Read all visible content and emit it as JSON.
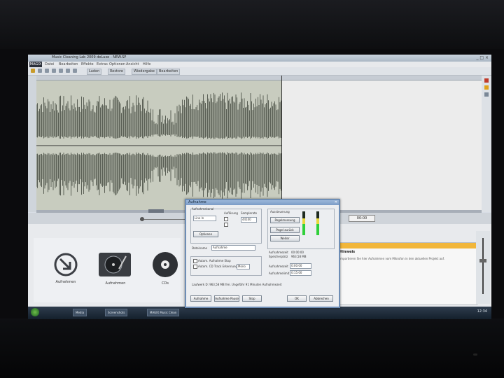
{
  "window": {
    "title": "Music Cleaning Lab 2009 deLuxe - NEW.SP",
    "controls": "_ □ ×"
  },
  "menubar": {
    "logo": "MAGIX",
    "items": [
      "Datei",
      "Bearbeiten",
      "Effekte",
      "Extras",
      "Optionen",
      "Ansicht",
      "Hilfe"
    ]
  },
  "toolbar": {
    "buttons": [
      "Laden",
      "Restore",
      "Wiedergabe",
      "Bearbeiten"
    ]
  },
  "transport": {
    "time": "00:00"
  },
  "sources": [
    {
      "label": "Aufnehmen",
      "icon": "microphone-arrow-icon"
    },
    {
      "label": "Aufnehmen",
      "icon": "turntable-icon"
    },
    {
      "label": "CDs",
      "icon": "cd-icon"
    }
  ],
  "infopane": {
    "heading": "Hinweis",
    "text": "Importieren Sie hier Aufnahmen vom Mikrofon in den aktuellen Projekt auf."
  },
  "dialog": {
    "title": "Aufnahme",
    "groups": {
      "source": "Aufnahmekanal",
      "channels": "Auflösung",
      "rate": "Samplerate",
      "level": "Aussteuerung"
    },
    "fields": {
      "device": "Line In",
      "rate": "44100",
      "filename": "Aufnahme",
      "samples": "Mono"
    },
    "labels": {
      "filename": "Dateiname",
      "autostart": "Autom. Aufnahme Stop",
      "autotrack": "Autom. CD Track Erkennung",
      "record_time": "Aufnahmezeit",
      "free_space": "Speicherplatz",
      "extra": "Aufnahmezeit",
      "limit": "Aufnahmelimit",
      "bottom_info": "Laufwerk D: 963,58 MB frei. Ungefähr 91 Minuten Aufnahmezeit"
    },
    "values": {
      "record_time": "00:00:00",
      "free_space": "963,58 MB",
      "time1": "0:00:00",
      "time2": "0:15:00"
    },
    "buttons": {
      "signal": "Pegelmessung",
      "reset": "Pegel zurück",
      "options": "Optionen",
      "settings": "Weiter",
      "record": "Aufnahme",
      "pause": "Aufnahme Pause",
      "stop": "Stop",
      "ok": "OK",
      "cancel": "Abbrechen"
    },
    "level_l": 0.55,
    "level_r": 0.6
  },
  "taskbar": {
    "items": [
      "Media",
      "Screenshots",
      "MAGIX Music Clean"
    ],
    "clock": "12:34"
  }
}
